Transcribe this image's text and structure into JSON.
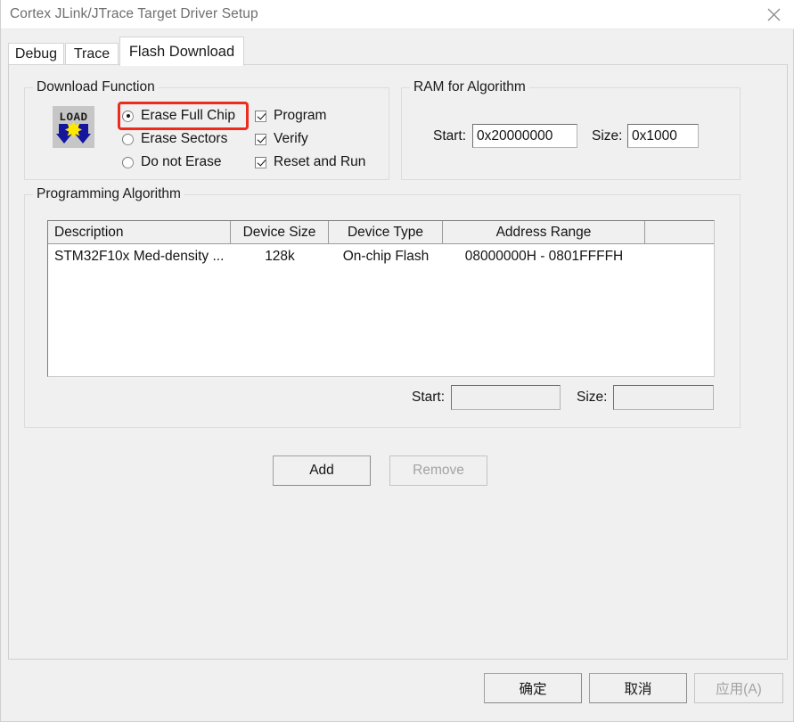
{
  "window": {
    "title": "Cortex JLink/JTrace Target Driver Setup",
    "close_icon": "close-icon"
  },
  "tabs": [
    {
      "label": "Debug",
      "active": false
    },
    {
      "label": "Trace",
      "active": false
    },
    {
      "label": "Flash Download",
      "active": true
    }
  ],
  "download_function": {
    "title": "Download Function",
    "icon": "load-icon",
    "erase_options": [
      {
        "label": "Erase Full Chip",
        "selected": true,
        "highlighted": true
      },
      {
        "label": "Erase Sectors",
        "selected": false,
        "highlighted": false
      },
      {
        "label": "Do not Erase",
        "selected": false,
        "highlighted": false
      }
    ],
    "checkboxes": [
      {
        "label": "Program",
        "checked": true
      },
      {
        "label": "Verify",
        "checked": true
      },
      {
        "label": "Reset and Run",
        "checked": true
      }
    ],
    "highlight_color": "#ef2b1f"
  },
  "ram_for_algorithm": {
    "title": "RAM for Algorithm",
    "start_label": "Start:",
    "start_value": "0x20000000",
    "size_label": "Size:",
    "size_value": "0x1000"
  },
  "programming_algorithm": {
    "title": "Programming Algorithm",
    "columns": [
      "Description",
      "Device Size",
      "Device Type",
      "Address Range",
      ""
    ],
    "rows": [
      {
        "description": "STM32F10x Med-density ...",
        "device_size": "128k",
        "device_type": "On-chip Flash",
        "address_range": "08000000H - 0801FFFFH",
        "extra": ""
      }
    ],
    "start_label": "Start:",
    "start_value": "",
    "size_label": "Size:",
    "size_value": "",
    "add_button": "Add",
    "remove_button": "Remove"
  },
  "dialog_buttons": {
    "ok": "确定",
    "cancel": "取消",
    "apply": "应用(A)"
  }
}
